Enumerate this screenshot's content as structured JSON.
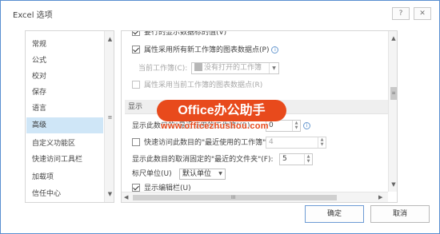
{
  "window": {
    "title": "Excel 选项",
    "help_glyph": "?",
    "close_glyph": "✕"
  },
  "nav": {
    "items": [
      {
        "label": "常规",
        "active": false
      },
      {
        "label": "公式",
        "active": false
      },
      {
        "label": "校对",
        "active": false
      },
      {
        "label": "保存",
        "active": false
      },
      {
        "label": "语言",
        "active": false
      },
      {
        "label": "高级",
        "active": true
      },
      {
        "label": "自定义功能区",
        "active": false
      },
      {
        "label": "快速访问工具栏",
        "active": false
      },
      {
        "label": "加载项",
        "active": false
      },
      {
        "label": "信任中心",
        "active": false
      }
    ]
  },
  "content": {
    "top_partial_label": "要行的显示数据标的值(V)",
    "chart_all_workbooks": {
      "label": "属性采用所有新工作簿的图表数据点(P)",
      "checked": true
    },
    "current_workbook_label": "当前工作簿(C):",
    "current_workbook_value": "没有打开的工作簿",
    "chart_current_workbook": {
      "label": "属性采用当前工作簿的图表数据点(R)",
      "checked": false
    },
    "section_display": "显示",
    "recent_docs": {
      "label": "显示此数目的\"最近使用的工作簿\"(R):",
      "value": "0"
    },
    "quick_access": {
      "label": "快速访问此数目的\"最近使用的工作簿\"(Q):",
      "value": "4",
      "checked": false
    },
    "unpinned_folders": {
      "label": "显示此数目的取消固定的\"最近的文件夹\"(F):",
      "value": "5"
    },
    "ruler_units": {
      "label": "标尺单位(U)",
      "value": "默认单位"
    },
    "formula_bar": {
      "label": "显示编辑栏(U)",
      "checked": true
    }
  },
  "scrollbars": {
    "up": "▲",
    "down": "▼",
    "left": "◀",
    "right": "▶",
    "grip_v": "≡",
    "grip_h": "III"
  },
  "footer": {
    "ok_label": "确定",
    "cancel_label": "取消"
  },
  "watermark": {
    "badge": "Office办公助手",
    "url": "www.officezhushou.com"
  }
}
